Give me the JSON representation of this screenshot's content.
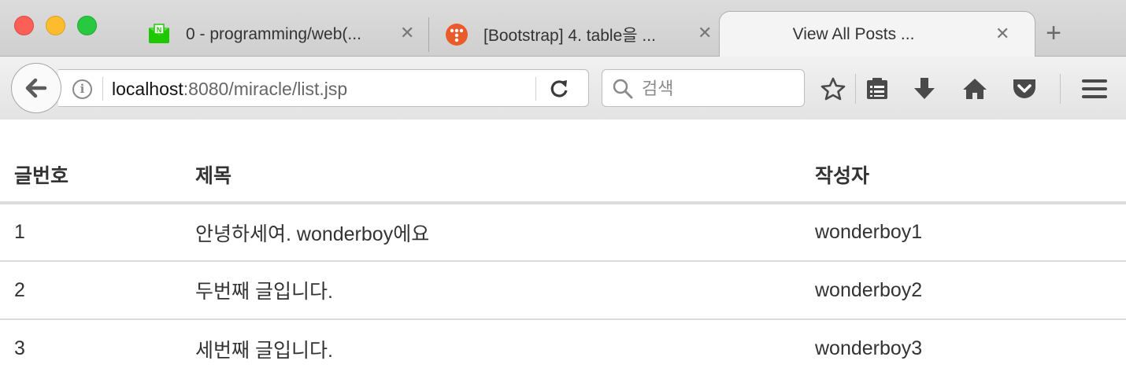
{
  "browser": {
    "tabs": [
      {
        "title": "0 - programming/web(...",
        "favicon": "naver-mail-icon",
        "active": false
      },
      {
        "title": "[Bootstrap] 4. table을 ...",
        "favicon": "tistory-icon",
        "active": false
      },
      {
        "title": "View All Posts ...",
        "favicon": "",
        "active": true
      }
    ],
    "new_tab_label": "+",
    "close_glyph": "✕",
    "url": {
      "host": "localhost",
      "rest": ":8080/miracle/list.jsp"
    },
    "search": {
      "placeholder": "검색"
    },
    "toolbar_icons": [
      "star-icon",
      "reading-list-icon",
      "download-icon",
      "home-icon",
      "pocket-icon",
      "menu-icon"
    ]
  },
  "table": {
    "headers": [
      "글번호",
      "제목",
      "작성자"
    ],
    "rows": [
      [
        "1",
        "안녕하세여. wonderboy에요",
        "wonderboy1"
      ],
      [
        "2",
        "두번째 글입니다.",
        "wonderboy2"
      ],
      [
        "3",
        "세번째 글입니다.",
        "wonderboy3"
      ]
    ]
  },
  "colors": {
    "chrome_bg": "#d6d6d6",
    "text": "#333333",
    "row_border": "#dddddd",
    "naver_green": "#1ec800",
    "tistory_orange": "#ea5b2c"
  }
}
